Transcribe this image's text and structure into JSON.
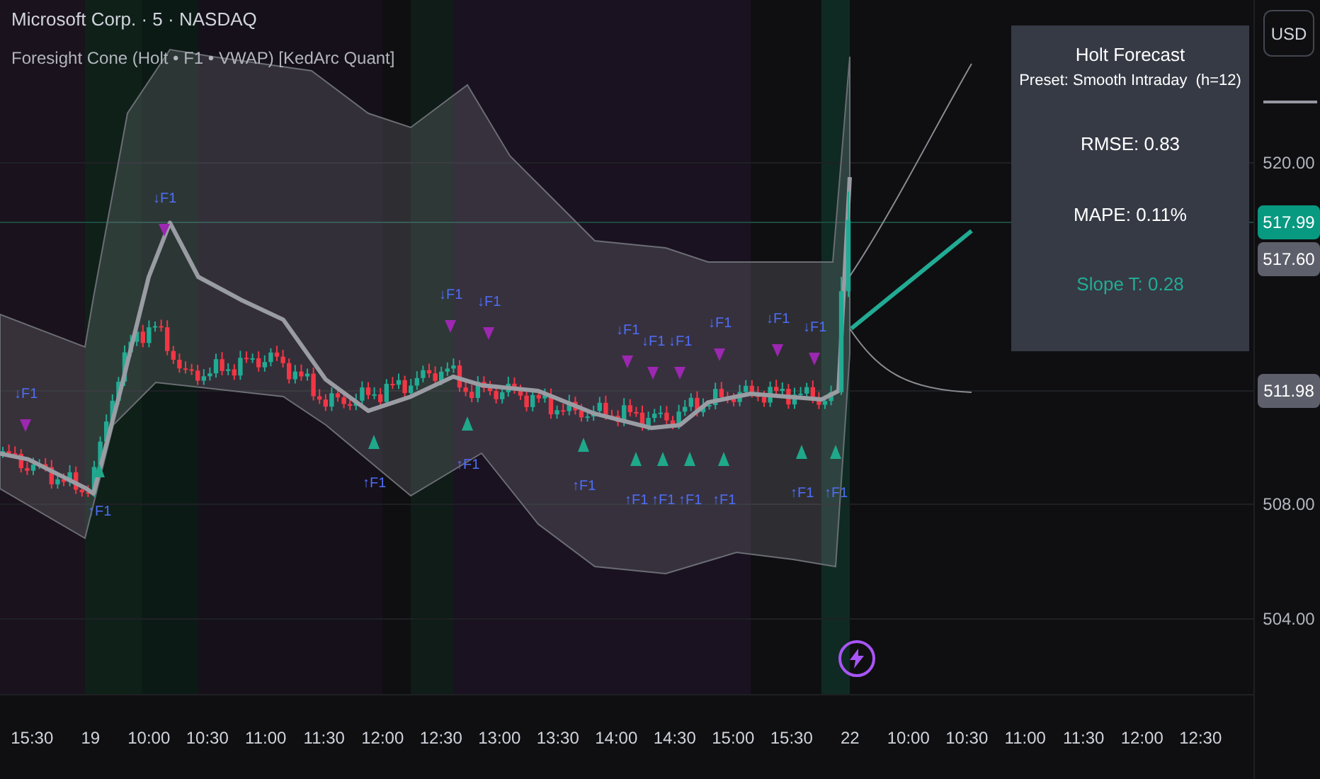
{
  "header": {
    "symbol": "Microsoft Corp. · 5 · NASDAQ",
    "indicator": "Foresight Cone (Holt • F1 • VWAP) [KedArc Quant]"
  },
  "forecast_panel": {
    "title": "Holt Forecast",
    "preset": "Preset: Smooth Intraday  (h=12)",
    "rmse": "RMSE: 0.83",
    "mape": "MAPE: 0.11%",
    "slope": "Slope T: 0.28"
  },
  "price_axis": {
    "currency_button": "USD",
    "labels": [
      {
        "text": "520.00",
        "kind": "tick"
      },
      {
        "text": "517.99",
        "kind": "last"
      },
      {
        "text": "517.60",
        "kind": "marker"
      },
      {
        "text": "511.98",
        "kind": "marker"
      },
      {
        "text": "508.00",
        "kind": "tick"
      },
      {
        "text": "504.00",
        "kind": "tick"
      }
    ]
  },
  "time_axis": [
    "15:30",
    "19",
    "10:00",
    "10:30",
    "11:00",
    "11:30",
    "12:00",
    "12:30",
    "13:00",
    "13:30",
    "14:00",
    "14:30",
    "15:00",
    "15:30",
    "22",
    "10:00",
    "10:30",
    "11:00",
    "11:30",
    "12:00",
    "12:30"
  ],
  "signals": [
    {
      "text": "↓F1",
      "kind": "sell"
    },
    {
      "text": "↓F1",
      "kind": "sell"
    },
    {
      "text": "↓F1",
      "kind": "sell"
    },
    {
      "text": "↓F1",
      "kind": "sell"
    },
    {
      "text": "↓F1",
      "kind": "sell"
    },
    {
      "text": "↓F1",
      "kind": "sell"
    },
    {
      "text": "↓F1",
      "kind": "sell"
    },
    {
      "text": "↓F1",
      "kind": "sell"
    },
    {
      "text": "↓F1",
      "kind": "sell"
    },
    {
      "text": "↓F1",
      "kind": "sell"
    },
    {
      "text": "↑F1",
      "kind": "buy"
    },
    {
      "text": "↑F1",
      "kind": "buy"
    },
    {
      "text": "↑F1",
      "kind": "buy"
    },
    {
      "text": "↑F1",
      "kind": "buy"
    },
    {
      "text": "↑F1",
      "kind": "buy"
    },
    {
      "text": "↑F1",
      "kind": "buy"
    },
    {
      "text": "↑F1",
      "kind": "buy"
    },
    {
      "text": "↑F1",
      "kind": "buy"
    },
    {
      "text": "↑F1",
      "kind": "buy"
    },
    {
      "text": "↑F1",
      "kind": "buy"
    }
  ]
}
